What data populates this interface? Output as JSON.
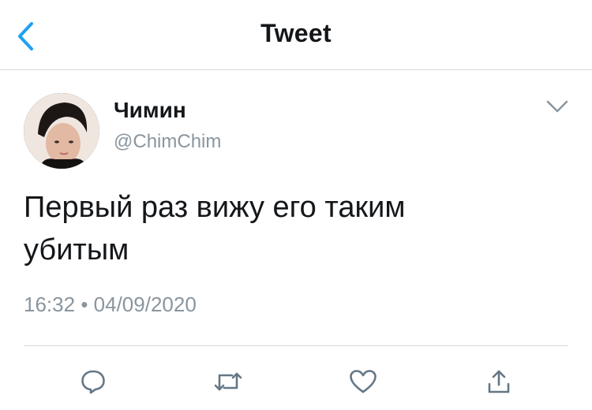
{
  "header": {
    "title": "Tweet",
    "back_icon": "chevron-left-icon",
    "accent_color": "#1da1f2"
  },
  "tweet": {
    "author_name": "Чимин",
    "author_handle": "@ChimChim",
    "text_line1": "Первый раз вижу его таким",
    "text_line2": "убитым",
    "time": "16:32",
    "separator": "•",
    "date": "04/09/2020"
  },
  "actions": [
    {
      "name": "reply",
      "icon": "reply-icon"
    },
    {
      "name": "retweet",
      "icon": "retweet-icon"
    },
    {
      "name": "like",
      "icon": "heart-icon"
    },
    {
      "name": "share",
      "icon": "share-icon"
    }
  ],
  "colors": {
    "text": "#14171a",
    "secondary": "#8a959e",
    "icon": "#657786",
    "divider": "#d6d9db"
  }
}
